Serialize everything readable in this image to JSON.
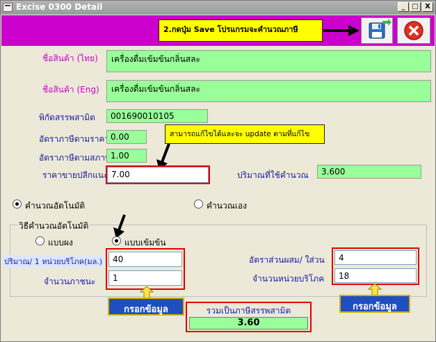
{
  "window": {
    "title": "Excise 0300 Detail",
    "controls": {
      "minimize": "_",
      "maximize": "□",
      "close": "X"
    }
  },
  "toolbar": {
    "hint": "2.กดปุ่ม Save โปรแกรมจะคำนวณภาษี",
    "save_icon": "save-disk-icon",
    "cancel_icon": "cancel-x-icon",
    "accent": "#cc00cc"
  },
  "form": {
    "product_name_th_label": "ชื่อสินค้า (ไทย)",
    "product_name_th": "เครื่องดื่มเข้มข้นกลิ่นสละ",
    "product_name_en_label": "ชื่อสินค้า (Eng)",
    "product_name_en": "เครื่องดื่มเข้มข้นกลิ่นสละ",
    "excise_code_label": "พิกัดสรรพสามิต",
    "excise_code": "001690010105",
    "ad_valorem_rate_label": "อัตราภาษีตามราคา",
    "ad_valorem_rate": "0.00",
    "specific_rate_label": "อัตราภาษีตามสภาพ",
    "specific_rate": "1.00",
    "retail_price_label": "ราคาขายปลีกแนะนำ",
    "retail_price": "7.00",
    "quantity_used_label": "ปริมาณที่ใช้คำนวณ",
    "quantity_used": "3.600",
    "edit_hint": "สามารถแก้ไขได้และจะ update ตามที่แก้ไข"
  },
  "calc_mode": {
    "auto_label": "คำนวณอัตโนมัติ",
    "manual_label": "คำนวณเอง",
    "selected": "auto"
  },
  "auto_method": {
    "group_title": "วิธีคำนวณอัตโนมัติ",
    "powder_label": "แบบผง",
    "concentrate_label": "แบบเข้มข้น",
    "selected": "concentrate",
    "volume_label": "ปริมาณ/ 1 หน่วยบริโภค(มล.)",
    "volume": "40",
    "containers_label": "จำนวนภาชนะ",
    "containers": "1",
    "mix_ratio_label": "อัตราส่วนผสม/ ใส่วน",
    "mix_ratio": "4",
    "servings_label": "จำนวนหน่วยบริโภค",
    "servings": "18",
    "fill_tag_left": "กรอกข้อมูล",
    "fill_tag_right": "กรอกข้อมูล"
  },
  "total": {
    "label": "รวมเป็นภาษีสรรพสามิต",
    "value": "3.60"
  }
}
